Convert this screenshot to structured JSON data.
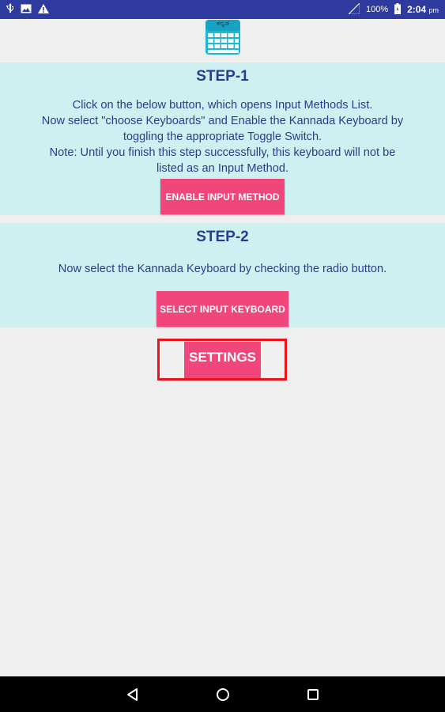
{
  "status_bar": {
    "battery_percent": "100%",
    "time": "2:04",
    "time_suffix": "pm"
  },
  "app_icon": {
    "label": "ಕನ್ನಡ"
  },
  "step1": {
    "title": "STEP-1",
    "text": "Click on the below button, which opens Input Methods List.\nNow select \"choose Keyboards\" and Enable the Kannada Keyboard by\ntoggling the appropriate Toggle Switch.\nNote: Until you finish this step successfully, this keyboard will not be\nlisted as an Input Method.",
    "button_label": "ENABLE INPUT METHOD"
  },
  "step2": {
    "title": "STEP-2",
    "text": "Now select the Kannada Keyboard by checking the radio button.",
    "button_label": "SELECT INPUT KEYBOARD"
  },
  "settings": {
    "button_label": "SETTINGS"
  },
  "colors": {
    "status_bar": "#2f3a9e",
    "panel_bg": "#cff0f0",
    "text": "#2b3b8f",
    "button": "#f0467c",
    "settings_border": "#e8141a"
  },
  "nav": {
    "icons": [
      "back-icon",
      "home-icon",
      "recents-icon"
    ]
  }
}
